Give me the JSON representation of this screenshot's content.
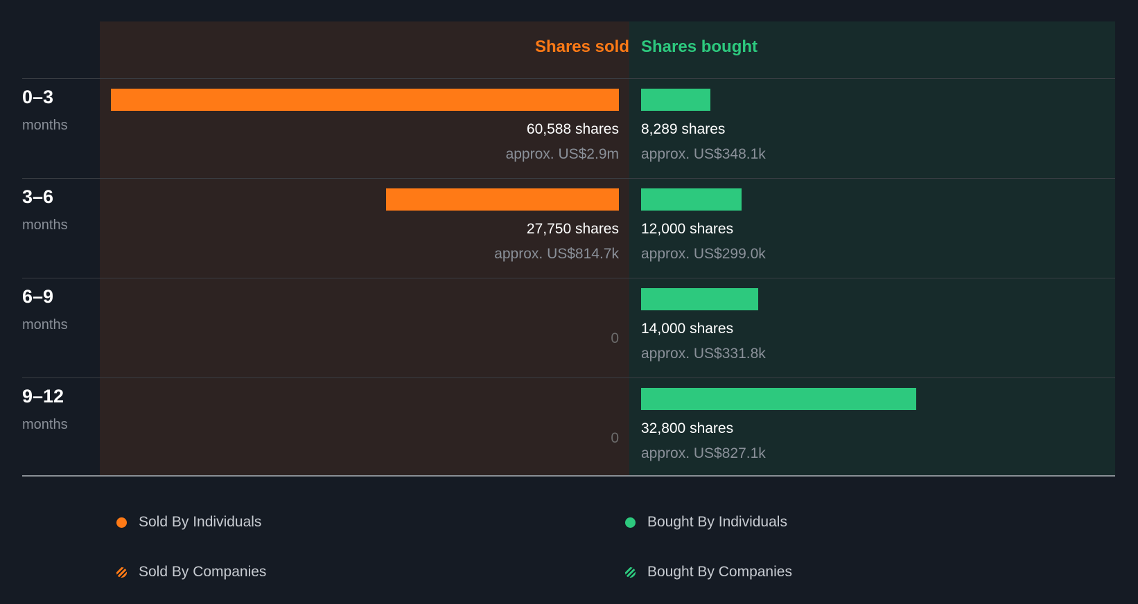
{
  "chart_data": {
    "type": "bar",
    "title": "",
    "headers": {
      "sold": "Shares sold",
      "bought": "Shares bought"
    },
    "unit_label": "months",
    "categories": [
      "0–3",
      "3–6",
      "6–9",
      "9–12"
    ],
    "series": [
      {
        "name": "Shares sold",
        "values": [
          60588,
          27750,
          0,
          0
        ],
        "labels": [
          "60,588 shares",
          "27,750 shares",
          "0",
          "0"
        ],
        "approx": [
          "approx. US$2.9m",
          "approx. US$814.7k",
          "",
          ""
        ]
      },
      {
        "name": "Shares bought",
        "values": [
          8289,
          12000,
          14000,
          32800
        ],
        "labels": [
          "8,289 shares",
          "12,000 shares",
          "14,000 shares",
          "32,800 shares"
        ],
        "approx": [
          "approx. US$348.1k",
          "approx. US$299.0k",
          "approx. US$331.8k",
          "approx. US$827.1k"
        ]
      }
    ],
    "max_value": 60588,
    "legend": [
      "Sold By Individuals",
      "Bought By Individuals",
      "Sold By Companies",
      "Bought By Companies"
    ],
    "colors": {
      "sold": "#ff7a16",
      "bought": "#2dc97e"
    }
  }
}
